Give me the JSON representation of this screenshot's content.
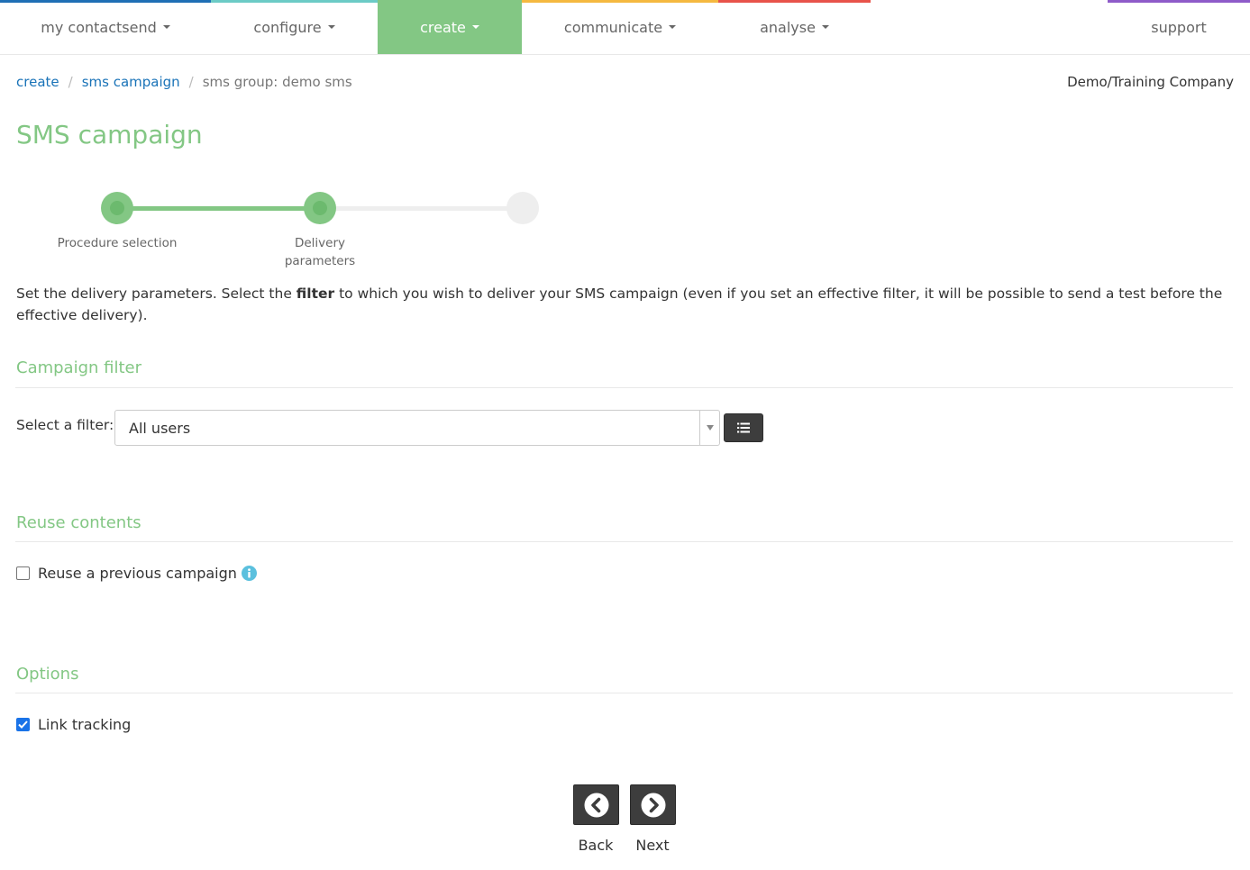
{
  "colors": {
    "accent_green": "#83c784",
    "link_blue": "#1a73b8",
    "nav_bar_colors": [
      "#1f6fb5",
      "#6ccbc6",
      "#83c784",
      "#f5b940",
      "#e8534a",
      "#ffffff",
      "#8e5bc9"
    ]
  },
  "nav": {
    "items": [
      {
        "label": "my contactsend",
        "has_caret": true
      },
      {
        "label": "configure",
        "has_caret": true
      },
      {
        "label": "create",
        "has_caret": true,
        "active": true
      },
      {
        "label": "communicate",
        "has_caret": true
      },
      {
        "label": "analyse",
        "has_caret": true
      },
      {
        "label": "support",
        "has_caret": false
      }
    ]
  },
  "breadcrumb": {
    "items": [
      "create",
      "sms campaign"
    ],
    "current": "sms group: demo sms"
  },
  "company": "Demo/Training Company",
  "page_title": "SMS campaign",
  "steps": {
    "items": [
      {
        "label": "Procedure selection",
        "state": "done"
      },
      {
        "label": "Delivery parameters",
        "state": "done"
      },
      {
        "label": "",
        "state": "todo"
      }
    ]
  },
  "intro": {
    "before": "Set the delivery parameters. Select the ",
    "bold": "filter",
    "after": " to which you wish to deliver your SMS campaign (even if you set an effective filter, it will be possible to send a test before the effective delivery)."
  },
  "sections": {
    "filter": {
      "title": "Campaign filter",
      "label": "Select a filter:",
      "selected": "All users",
      "list_icon": "list-icon"
    },
    "reuse": {
      "title": "Reuse contents",
      "checkbox_label": "Reuse a previous campaign",
      "checked": false,
      "info_icon": "info-icon"
    },
    "options": {
      "title": "Options",
      "checkbox_label": "Link tracking",
      "checked": true
    }
  },
  "footer": {
    "back_label": "Back",
    "next_label": "Next",
    "back_icon": "chevron-left-circle-icon",
    "next_icon": "chevron-right-circle-icon"
  }
}
